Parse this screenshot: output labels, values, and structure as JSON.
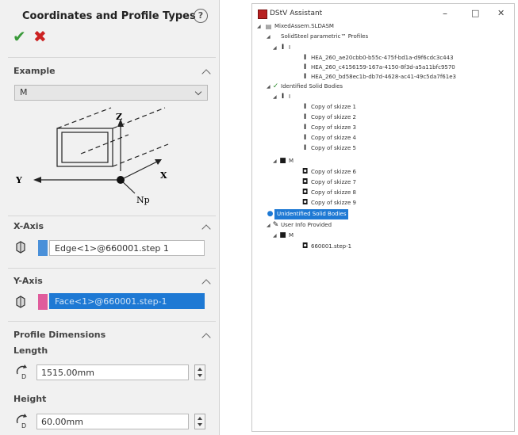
{
  "left_panel": {
    "title": "Coordinates and Profile Types",
    "help_glyph": "?",
    "ok_glyph": "✔",
    "cancel_glyph": "✖",
    "example": {
      "heading": "Example",
      "selected": "M",
      "diagram_labels": {
        "z": "Z",
        "y": "Y",
        "x": "X",
        "np": "Np"
      }
    },
    "x_axis": {
      "heading": "X-Axis",
      "value": "Edge<1>@660001.step 1",
      "swatch_color": "#4a90d9"
    },
    "y_axis": {
      "heading": "Y-Axis",
      "value": "Face<1>@660001.step-1",
      "swatch_color": "#e05c9c"
    },
    "profile_dimensions": {
      "heading": "Profile Dimensions",
      "length_label": "Length",
      "length_value": "1515.00mm",
      "height_label": "Height",
      "height_value": "60.00mm"
    }
  },
  "dstv": {
    "window_title": "DStV Assistant",
    "controls": {
      "minimize": "–",
      "maximize": "□",
      "close": "✕"
    },
    "tree": {
      "root": "MixedAssem.SLDASM",
      "solidsteel_profiles": "SolidSteel parametric™ Profiles",
      "group_i": "I",
      "profiles": [
        "HEA_260_ae20cbb0-b55c-475f-bd1a-d9f6cdc3c443",
        "HEA_260_c4156159-167a-4150-8f3d-a5a11bfc9570",
        "HEA_260_bd58ec1b-db7d-4628-ac41-49c5da7f61e3"
      ],
      "identified": "Identified Solid Bodies",
      "identified_i": "I",
      "copies_i": [
        "Copy of skizze 1",
        "Copy of skizze 2",
        "Copy of skizze 3",
        "Copy of skizze 4",
        "Copy of skizze 5"
      ],
      "identified_m": "M",
      "copies_m": [
        "Copy of skizze 6",
        "Copy of skizze 7",
        "Copy of skizze 8",
        "Copy of skizze 9"
      ],
      "unidentified": "Unidentified Solid Bodies",
      "user_info": "User Info Provided",
      "user_m": "M",
      "user_step": "660001.step-1"
    }
  },
  "colors": {
    "highlight": "#1e79d4",
    "ok": "#3a9a3a",
    "cancel": "#cc2222"
  }
}
